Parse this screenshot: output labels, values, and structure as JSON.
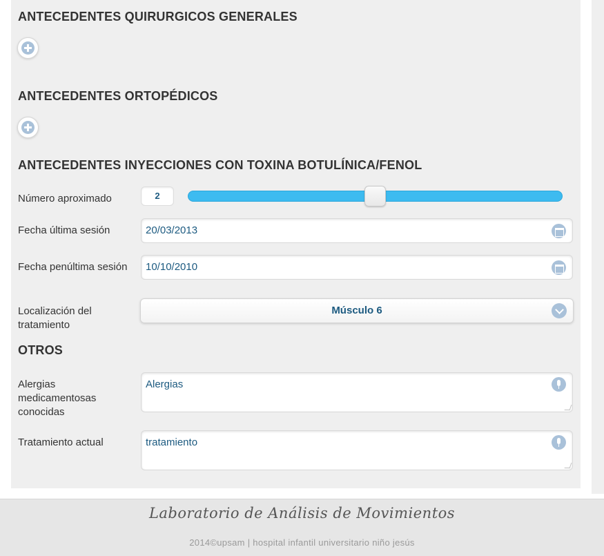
{
  "sections": {
    "quirurgicos": "ANTECEDENTES QUIRURGICOS GENERALES",
    "ortopedicos": "ANTECEDENTES ORTOPÉDICOS",
    "inyecciones": "ANTECEDENTES INYECCIONES CON TOXINA BOTULÍNICA/FENOL",
    "otros": "OTROS"
  },
  "fields": {
    "numero": {
      "label": "Número aproximado",
      "value": "2",
      "slider_fraction": 0.5
    },
    "fecha_ultima": {
      "label": "Fecha última sesión",
      "value": "20/03/2013"
    },
    "fecha_penultima": {
      "label": "Fecha penúltima sesión",
      "value": "10/10/2010"
    },
    "localizacion": {
      "label": "Localización del tratamiento",
      "value": "Músculo 6"
    },
    "alergias": {
      "label": "Alergias medicamentosas conocidas",
      "value": "Alergias"
    },
    "tratamiento": {
      "label": "Tratamiento actual",
      "value": "tratamiento"
    }
  },
  "icons": {
    "add": "plus-icon",
    "calendar": "calendar-icon",
    "mic": "microphone-icon",
    "dropdown": "chevron-down-icon"
  },
  "colors": {
    "accent": "#3dbbf0",
    "value_text": "#1c5a80",
    "icon_bg": "#a9c1d9"
  },
  "footer": {
    "brand": "Laboratorio de Análisis de Movimientos",
    "credit": "2014©upsam | hospital infantil universitario niño jesús"
  }
}
